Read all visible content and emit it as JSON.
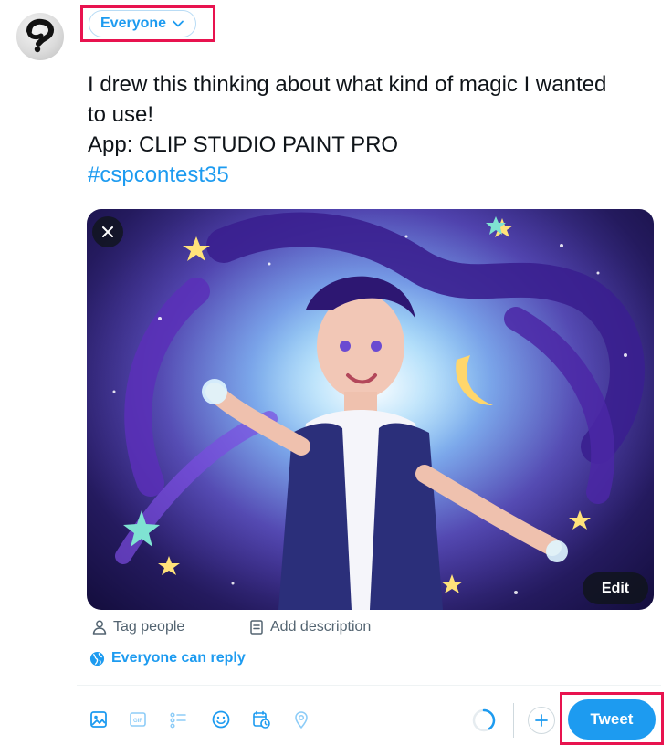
{
  "composer": {
    "audience_label": "Everyone",
    "text_lines": [
      "I drew this thinking about what kind of magic I wanted",
      "to use!",
      "App: CLIP STUDIO PAINT PRO"
    ],
    "hashtag": "#cspcontest35",
    "media": {
      "edit_label": "Edit"
    },
    "media_actions": {
      "tag_people": "Tag people",
      "add_description": "Add description"
    },
    "reply_setting": "Everyone can reply",
    "toolbar": {
      "icons": [
        "image-icon",
        "gif-icon",
        "poll-icon",
        "emoji-icon",
        "schedule-icon",
        "location-icon"
      ],
      "tweet_label": "Tweet"
    }
  },
  "colors": {
    "accent": "#1d9bf0",
    "highlight": "#e8134f",
    "text": "#0f1419",
    "muted": "#536471"
  }
}
